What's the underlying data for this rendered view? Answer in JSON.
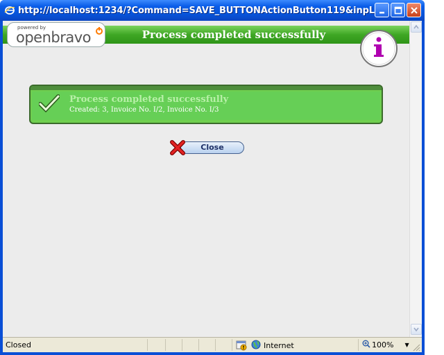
{
  "window": {
    "title": "http://localhost:1234/?Command=SAVE_BUTTONActionButton119&inpLastField..."
  },
  "header": {
    "logo_powered": "powered by",
    "logo_name": "openbravo",
    "title": "Process completed successfully"
  },
  "message": {
    "title": "Process completed successfully",
    "text": "Created: 3, Invoice No. I/2, Invoice No. I/3"
  },
  "buttons": {
    "close_label": "Close"
  },
  "statusbar": {
    "status": "Closed",
    "zone": "Internet",
    "zoom": "100%"
  },
  "colors": {
    "accent_green": "#3fa725",
    "message_green": "#6fcf4f"
  }
}
